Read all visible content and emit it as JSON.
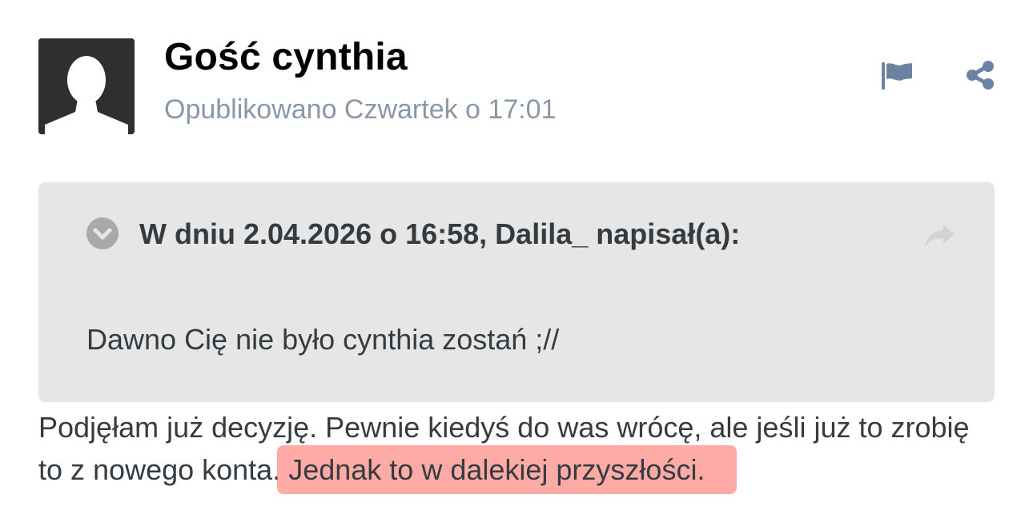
{
  "post": {
    "author": "Gość cynthia",
    "meta": "Opublikowano Czwartek o 17:01"
  },
  "quote": {
    "citation": "W dniu 2.04.2026 o 16:58, Dalila_ napisał(a):",
    "text": "Dawno Cię nie było cynthia zostań ;//"
  },
  "body": {
    "text_plain": "Podjęłam już decyzję. Pewnie kiedyś do was wrócę, ale jeśli już to zrobię to z nowego konta.",
    "text_highlighted": "Jednak to w dalekiej przyszłości."
  },
  "icons": {
    "avatar": "default-avatar-silhouette",
    "report": "flag-icon",
    "share": "share-icon",
    "quote_toggle": "chevron-down-circle-icon",
    "quote_jump": "forward-arrow-icon"
  },
  "colors": {
    "meta_text": "#8a97a7",
    "icon_blue": "#6b82a0",
    "quote_bg": "#e6e6e6",
    "highlight": "#ff786e"
  }
}
